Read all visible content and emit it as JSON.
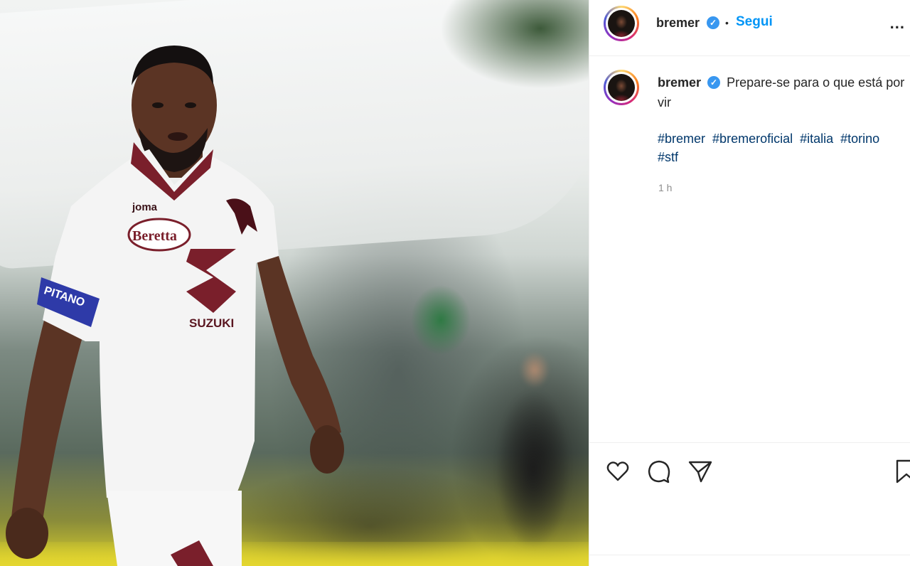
{
  "post": {
    "author": "bremer",
    "follow_label": "Segui",
    "separator": "•",
    "more_label": "...",
    "verified_mark": "✓",
    "caption_text": "Prepare-se para o que está por vir",
    "hashtags": [
      "#bremer",
      "#bremeroficial",
      "#italia",
      "#torino",
      "#stf"
    ],
    "timestamp": "1 h"
  },
  "photo": {
    "kit_brand": "joma",
    "sponsor_main": "Beretta",
    "sponsor_shirt": "SUZUKI",
    "armband": "PITANO"
  },
  "icons": {
    "like": "heart-icon",
    "comment": "comment-icon",
    "share": "send-icon",
    "save": "bookmark-icon",
    "verified": "verified-badge-icon"
  },
  "colors": {
    "link_blue": "#0095f6",
    "hashtag_blue": "#00376b",
    "verified_blue": "#3897f0",
    "jersey_maroon": "#7a1f2b"
  }
}
